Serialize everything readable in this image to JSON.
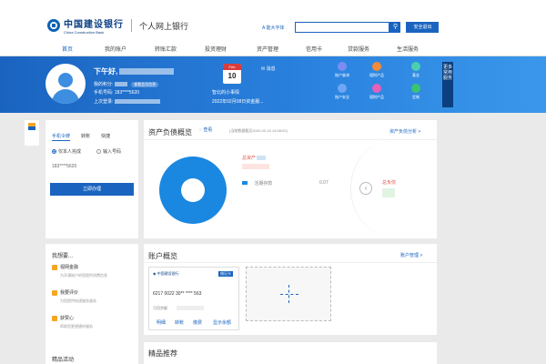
{
  "header": {
    "logo_cn": "中国建设银行",
    "logo_en": "China Construction Bank",
    "portal": "个人网上银行",
    "elder_mode": "A 能大字体",
    "search_placeholder": "",
    "exit_label": "安全退出"
  },
  "nav": [
    "首页",
    "我的账户",
    "转账汇款",
    "投资理财",
    "资产管理",
    "信用卡",
    "贷款服务",
    "生活服务"
  ],
  "user": {
    "greeting": "下午好,",
    "points_label": "我的积分:",
    "points_tag": "查看会员信息",
    "phone_label": "手机号码:",
    "phone_value": "183****5620",
    "last_login_label": "上次登录:"
  },
  "calendar": {
    "month": "Feb",
    "day": "10",
    "tip1": "智北的小事情",
    "tip2": "2022年02月08日资金服..."
  },
  "message": "消息",
  "quick_actions": [
    "账户查询",
    "理财产品",
    "基金",
    "账户安全",
    "理财产品",
    "定制"
  ],
  "side_tab": "更多常用服务",
  "login_panel": {
    "tabs": [
      "手机令牌",
      "转账",
      "快捷"
    ],
    "radio_this": "仅本人完成",
    "radio_input": "输入号码",
    "phone": "183****5620",
    "button": "立即办理"
  },
  "features": {
    "title": "我想要...",
    "items": [
      {
        "name": "视网金融",
        "desc": "为开通账户的您提供消费信息"
      },
      {
        "name": "我要评价",
        "desc": "为您提供快速服务服务"
      },
      {
        "name": "获赞心",
        "desc": "帮助您更便捷的服务"
      }
    ],
    "more": "精品活动"
  },
  "asset_overview": {
    "title": "资产负债概览",
    "detail": "查看",
    "asof": "(当前数据截至2022-02-10 14:08:02)",
    "analysis_link": "资产负债分析 >",
    "total_assets_label": "总资产",
    "legend_deposit": "活期存款",
    "deposit_value": "0.07",
    "total_liab_label": "总负债",
    "colors": {
      "assets": "#1a88e0"
    }
  },
  "account_overview": {
    "title": "账户概览",
    "manage_link": "账户管理 >",
    "card_bank": "中国建设银行",
    "card_tag": "借记卡",
    "card_no": "6217 0022 30** **** 563",
    "balance_label": "可用余额",
    "actions": [
      "明细",
      "转账",
      "缴费",
      "显示余额"
    ]
  },
  "recommend_title": "精品推荐"
}
